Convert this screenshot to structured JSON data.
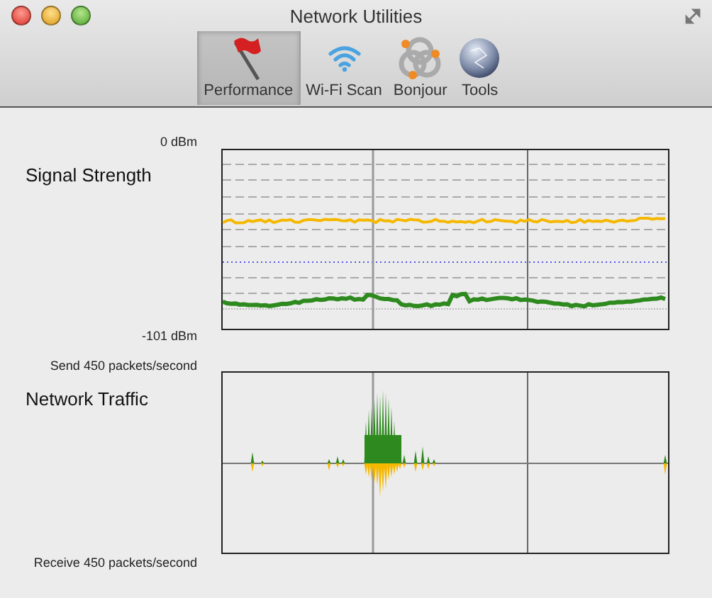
{
  "window": {
    "title": "Network Utilities"
  },
  "toolbar": [
    {
      "label": "Performance",
      "selected": true
    },
    {
      "label": "Wi-Fi Scan",
      "selected": false
    },
    {
      "label": "Bonjour",
      "selected": false
    },
    {
      "label": "Tools",
      "selected": false
    }
  ],
  "signal_strength": {
    "top_label": "0 dBm",
    "title": "Signal Strength",
    "bottom_label": "-101 dBm"
  },
  "network_traffic": {
    "top_label": "Send 450 packets/second",
    "title": "Network Traffic",
    "bottom_label": "Receive 450 packets/second"
  }
}
